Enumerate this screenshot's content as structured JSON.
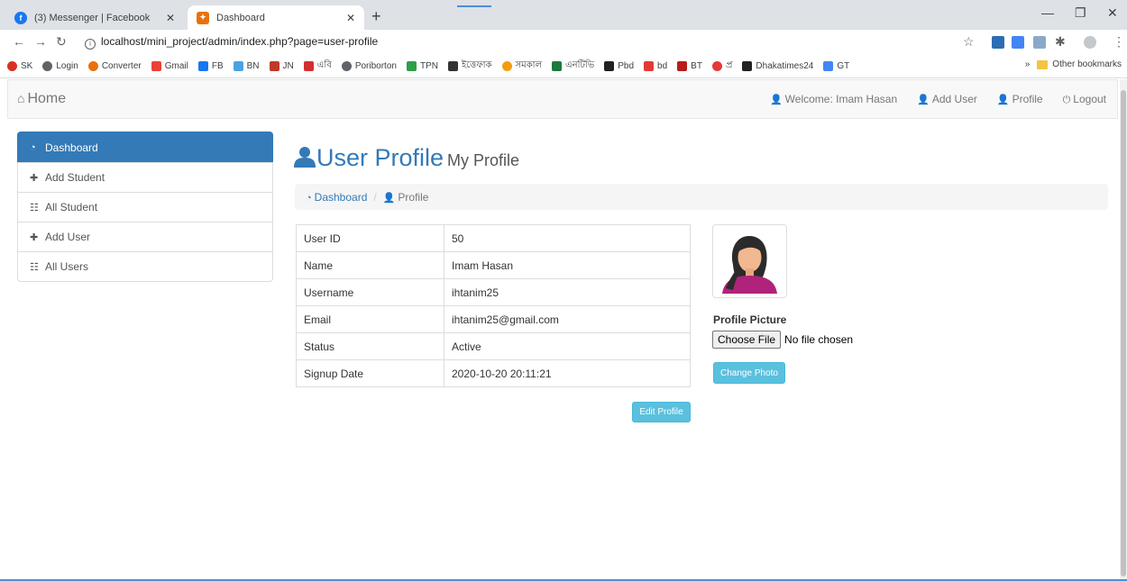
{
  "browser": {
    "tabs": [
      {
        "title": "(3) Messenger | Facebook",
        "icon": "facebook-icon"
      },
      {
        "title": "Dashboard",
        "icon": "dashboard-favicon"
      }
    ],
    "url": "localhost/mini_project/admin/index.php?page=user-profile",
    "bookmarks": [
      "SK",
      "Login",
      "Converter",
      "Gmail",
      "FB",
      "BN",
      "JN",
      "এবি",
      "Poriborton",
      "TPN",
      "ইত্তেফাক",
      "সমকাল",
      "এনটিভি",
      "Pbd",
      "bd",
      "BT",
      "প্র",
      "Dhakatimes24",
      "GT"
    ],
    "other_bookmarks": "Other bookmarks",
    "overflow": "»"
  },
  "navbar": {
    "brand": "Home",
    "welcome": "Welcome: Imam Hasan",
    "add_user": "Add User",
    "profile": "Profile",
    "logout": "Logout"
  },
  "sidebar": {
    "items": [
      {
        "label": "Dashboard",
        "icon": "dashboard-icon"
      },
      {
        "label": "Add Student",
        "icon": "user-plus-icon"
      },
      {
        "label": "All Student",
        "icon": "users-icon"
      },
      {
        "label": "Add User",
        "icon": "user-plus-icon"
      },
      {
        "label": "All Users",
        "icon": "users-icon"
      }
    ]
  },
  "main": {
    "title": "User Profile",
    "subtitle": "My Profile",
    "breadcrumb": {
      "home": "Dashboard",
      "current": "Profile"
    },
    "profile": [
      {
        "label": "User ID",
        "value": "50"
      },
      {
        "label": "Name",
        "value": "Imam Hasan"
      },
      {
        "label": "Username",
        "value": "ihtanim25"
      },
      {
        "label": "Email",
        "value": "ihtanim25@gmail.com"
      },
      {
        "label": "Status",
        "value": "Active"
      },
      {
        "label": "Signup Date",
        "value": "2020-10-20 20:11:21"
      }
    ],
    "edit_button": "Edit Profile",
    "picture_label": "Profile Picture",
    "choose_file": "Choose File",
    "no_file": "No file chosen",
    "change_photo": "Change Photo"
  },
  "colors": {
    "primary": "#337ab7",
    "info": "#5bc0de"
  }
}
